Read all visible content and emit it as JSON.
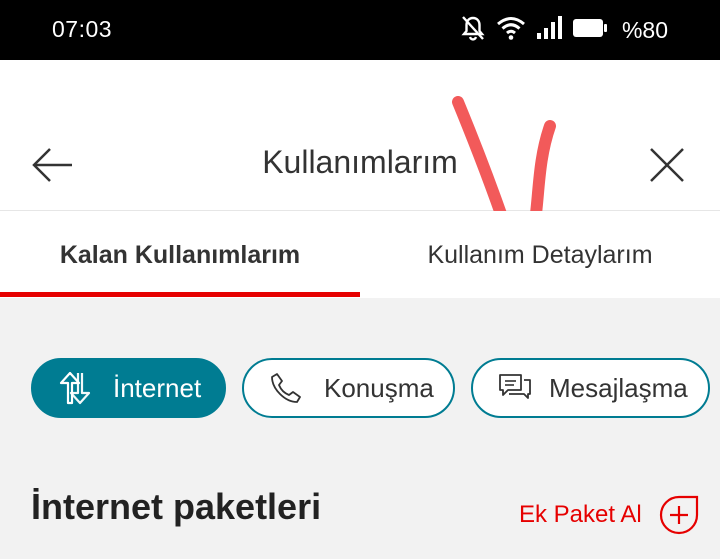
{
  "status_bar": {
    "time": "07:03",
    "battery": "%80",
    "icons": [
      "notifications-off-icon",
      "wifi-icon",
      "signal-icon",
      "battery-icon"
    ]
  },
  "header": {
    "title": "Kullanımlarım",
    "back_icon": "arrow-left-icon",
    "close_icon": "close-icon"
  },
  "tabs": [
    {
      "label": "Kalan Kullanımlarım",
      "active": true
    },
    {
      "label": "Kullanım Detaylarım",
      "active": false
    }
  ],
  "filters": [
    {
      "label": "İnternet",
      "icon": "data-transfer-icon",
      "active": true
    },
    {
      "label": "Konuşma",
      "icon": "phone-icon",
      "active": false
    },
    {
      "label": "Mesajlaşma",
      "icon": "message-icon",
      "active": false
    }
  ],
  "section": {
    "title": "İnternet paketleri",
    "action_label": "Ek Paket Al",
    "action_icon": "add-circle-icon"
  },
  "colors": {
    "accent": "#e60000",
    "teal": "#007c92",
    "annotation": "#f25a5a"
  }
}
